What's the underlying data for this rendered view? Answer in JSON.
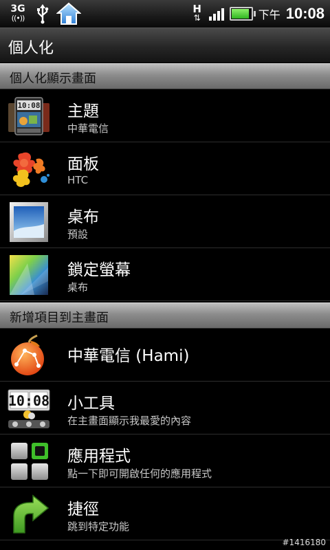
{
  "status_bar": {
    "network_type": "3G",
    "network_sub": "((•))",
    "data_indicator": "H",
    "data_arrows": "⇅",
    "am_pm": "下午",
    "time": "10:08",
    "icons": [
      "3g-signal-icon",
      "usb-icon",
      "home-icon",
      "data-activity-icon",
      "signal-strength-icon",
      "battery-icon"
    ],
    "battery_level": 0.9
  },
  "title_bar": {
    "title": "個人化"
  },
  "sections": [
    {
      "header": "個人化顯示畫面",
      "items": [
        {
          "primary": "主題",
          "secondary": "中華電信",
          "icon": "theme-icon"
        },
        {
          "primary": "面板",
          "secondary": "HTC",
          "icon": "skin-icon"
        },
        {
          "primary": "桌布",
          "secondary": "預設",
          "icon": "wallpaper-icon"
        },
        {
          "primary": "鎖定螢幕",
          "secondary": "桌布",
          "icon": "lockscreen-icon"
        }
      ]
    },
    {
      "header": "新增項目到主畫面",
      "items": [
        {
          "primary": "中華電信 (Hami)",
          "secondary": "",
          "icon": "hami-icon"
        },
        {
          "primary": "小工具",
          "secondary": "在主畫面顯示我最愛的內容",
          "icon": "widget-icon"
        },
        {
          "primary": "應用程式",
          "secondary": "點一下即可開啟任何的應用程式",
          "icon": "apps-icon"
        },
        {
          "primary": "捷徑",
          "secondary": "跳到特定功能",
          "icon": "shortcut-icon"
        }
      ]
    }
  ],
  "widget_clock_text": "10:08",
  "watermark": "#1416180",
  "colors": {
    "section_header": "#a0a0a0",
    "background": "#000000",
    "battery_fill": "#3cc22a",
    "shortcut_arrow": "#5fb52f"
  }
}
